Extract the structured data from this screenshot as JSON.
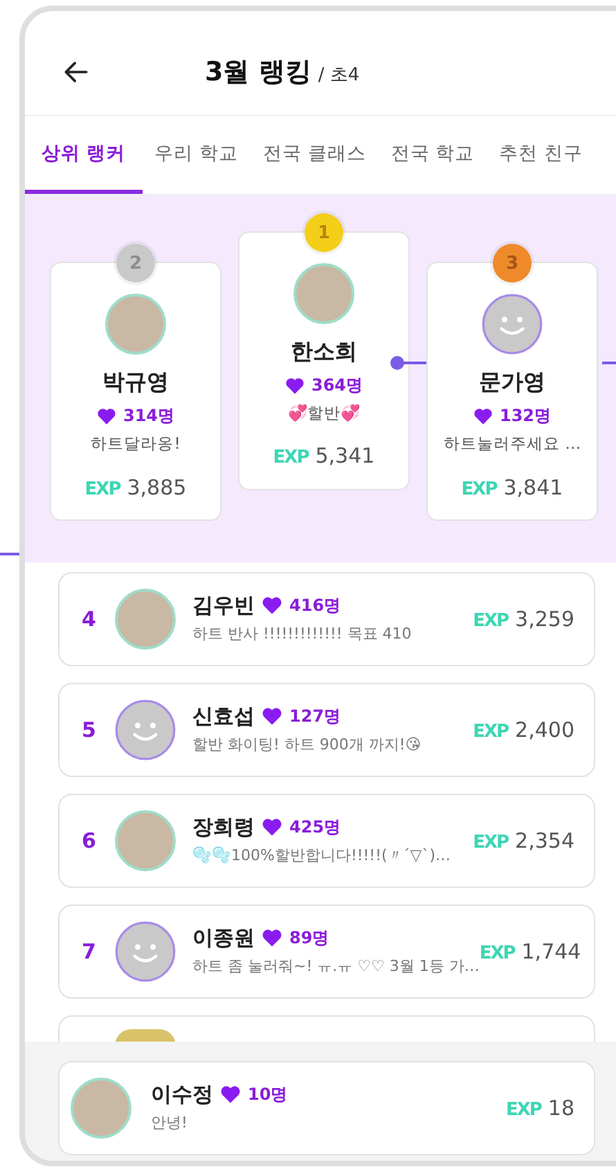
{
  "header": {
    "title": "3월 랭킹",
    "subtitle": "/ 초4"
  },
  "tabs": [
    {
      "label": "상위 랭커",
      "selected": true
    },
    {
      "label": "우리 학교",
      "selected": false
    },
    {
      "label": "전국 클래스",
      "selected": false
    },
    {
      "label": "전국 학교",
      "selected": false
    },
    {
      "label": "추천 친구",
      "selected": false
    }
  ],
  "podium": [
    {
      "kind": "silver",
      "rank": "2",
      "avatar": {
        "kind": "photo"
      },
      "name": "박규영",
      "hearts": "314명",
      "message": "하트달라옹!",
      "exp_label": "EXP",
      "exp": "3,885"
    },
    {
      "kind": "gold",
      "rank": "1",
      "avatar": {
        "kind": "photo"
      },
      "name": "한소희",
      "hearts": "364명",
      "message": "💞할반💞",
      "exp_label": "EXP",
      "exp": "5,341"
    },
    {
      "kind": "bronze",
      "rank": "3",
      "avatar": {
        "kind": "default"
      },
      "name": "문가영",
      "hearts": "132명",
      "message": "하트눌러주세요 …",
      "exp_label": "EXP",
      "exp": "3,841"
    }
  ],
  "ranking": [
    {
      "rank": "4",
      "avatar": {
        "kind": "photo"
      },
      "name": "김우빈",
      "hearts": "416명",
      "message": "하트 반사 !!!!!!!!!!!!! 목표 410",
      "exp_label": "EXP",
      "exp": "3,259"
    },
    {
      "rank": "5",
      "avatar": {
        "kind": "default"
      },
      "name": "신효섭",
      "hearts": "127명",
      "message": "할반 화이팅! 하트 900개 까지!😘",
      "exp_label": "EXP",
      "exp": "2,400"
    },
    {
      "rank": "6",
      "avatar": {
        "kind": "photo"
      },
      "name": "장희령",
      "hearts": "425명",
      "message": "🫧🫧100%할반합니다!!!!!(〃´▽`)…",
      "exp_label": "EXP",
      "exp": "2,354"
    },
    {
      "rank": "7",
      "avatar": {
        "kind": "default"
      },
      "name": "이종원",
      "hearts": "89명",
      "message": "하트 좀 눌러줘~! ㅠ.ㅠ ♡♡ 3월 1등 가…",
      "exp_label": "EXP",
      "exp": "1,744"
    }
  ],
  "my_rank": {
    "avatar": {
      "kind": "photo"
    },
    "name": "이수정",
    "hearts": "10명",
    "message": "안녕!",
    "exp_label": "EXP",
    "exp": "18"
  }
}
